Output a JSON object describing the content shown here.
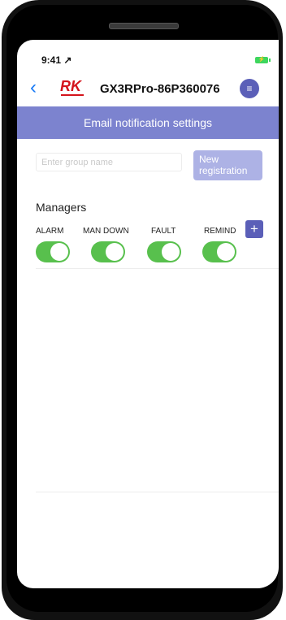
{
  "status_bar": {
    "time": "9:41 ↗"
  },
  "header": {
    "back_icon": "chevron-left-icon",
    "logo_letters": "RK",
    "device_name": "GX3RPro-86P360076",
    "menu_icon": "menu-icon"
  },
  "banner": {
    "title": "Email notification settings"
  },
  "group_form": {
    "placeholder": "Enter group name",
    "value": "",
    "button_label": "New registration"
  },
  "managers": {
    "title": "Managers",
    "columns": [
      {
        "label": "ALARM",
        "enabled": true
      },
      {
        "label": "MAN DOWN",
        "enabled": true
      },
      {
        "label": "FAULT",
        "enabled": true
      },
      {
        "label": "REMIND",
        "enabled": true
      }
    ],
    "add_icon": "plus-icon"
  },
  "colors": {
    "accent": "#5b5fb8",
    "banner": "#7c83cf",
    "toggle_on": "#58c04d",
    "back": "#1b7cf6"
  }
}
